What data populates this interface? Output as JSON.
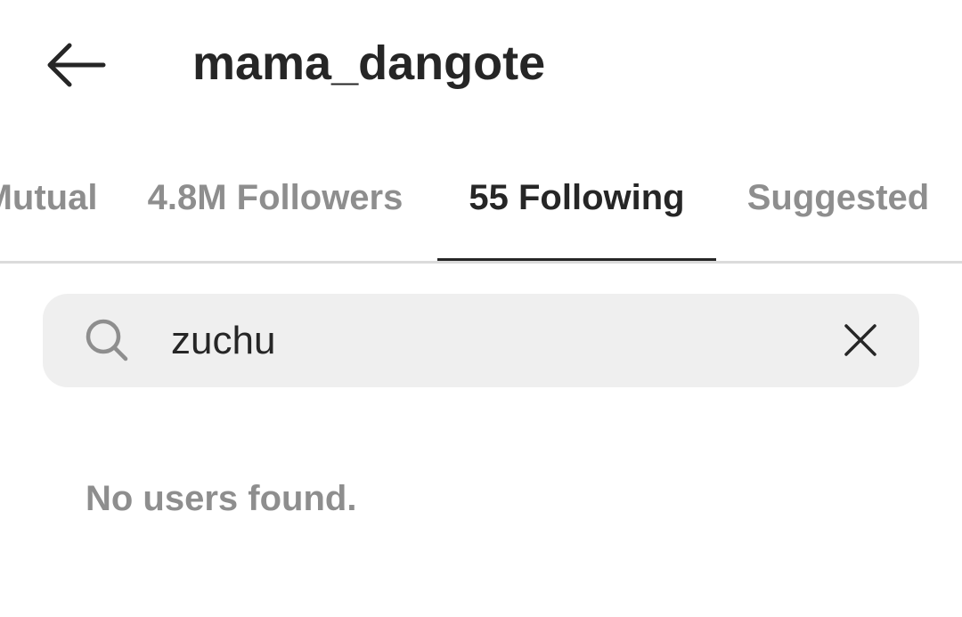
{
  "header": {
    "title": "mama_dangote",
    "back_icon": "arrow-left-icon"
  },
  "tabs": [
    {
      "label": "Mutual",
      "active": false
    },
    {
      "label": "4.8M Followers",
      "active": false
    },
    {
      "label": "55 Following",
      "active": true
    },
    {
      "label": "Suggested",
      "active": false
    }
  ],
  "search": {
    "value": "zuchu",
    "icon": "search-icon",
    "clear_icon": "close-icon"
  },
  "results": {
    "empty_message": "No users found."
  },
  "colors": {
    "primary_text": "#262626",
    "secondary_text": "#8e8e8e",
    "search_bg": "#efefef",
    "divider": "#dbdbdb"
  }
}
